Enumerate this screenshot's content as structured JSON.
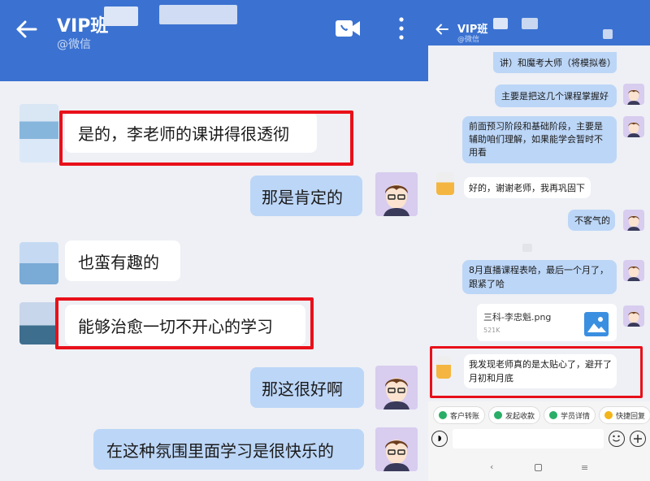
{
  "left": {
    "header": {
      "title": "VIP班",
      "subtitle": "@微信"
    },
    "messages": [
      "是的，李老师的课讲得很透彻",
      "那是肯定的",
      "也蛮有趣的",
      "能够治愈一切不开心的学习",
      "那这很好啊",
      "在这种氛围里面学习是很快乐的"
    ]
  },
  "right": {
    "header": {
      "title": "VIP班",
      "subtitle": "@微信"
    },
    "messages": [
      "讲）和魔考大师（将模拟卷）",
      "主要是把这几个课程掌握好",
      "前面预习阶段和基础阶段，主要是辅助咱们理解，如果能学会暂时不用看",
      "好的，谢谢老师，我再巩固下",
      "不客气的",
      "8月直播课程表哈，最后一个月了，跟紧了哈",
      "我发现老师真的是太贴心了，避开了月初和月底"
    ],
    "file": {
      "name": "三科-李忠魁.png",
      "size": "521K"
    },
    "quick_actions": [
      "客户转账",
      "发起收款",
      "学员详情",
      "快捷回复"
    ],
    "colors": {
      "green": "#2aae67",
      "yellow": "#f2b51a",
      "blue": "#3b72d1"
    }
  }
}
